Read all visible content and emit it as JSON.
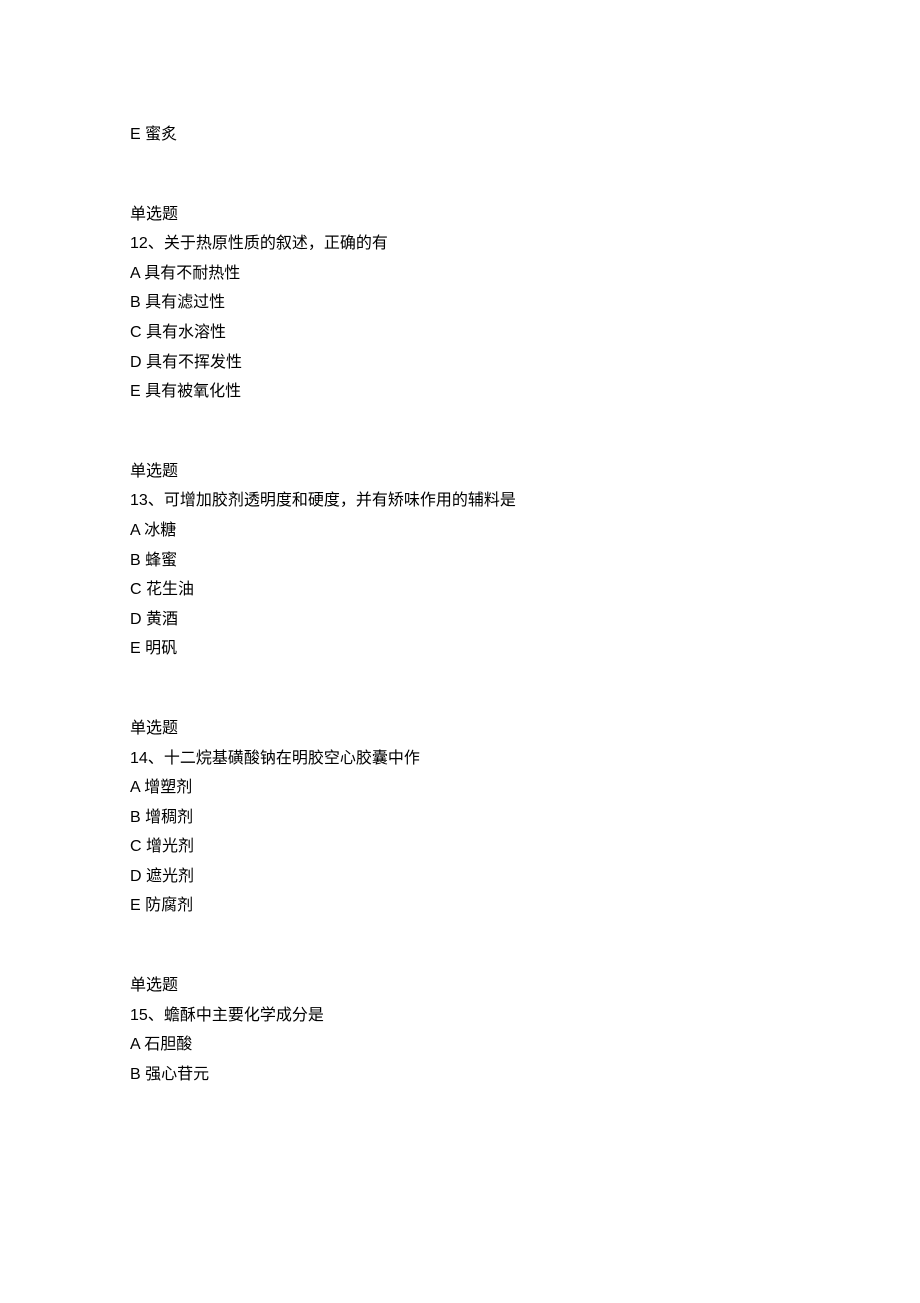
{
  "orphan_option": "E 蜜炙",
  "questions": [
    {
      "type": "单选题",
      "number": "12、",
      "text": "关于热原性质的叙述，正确的有",
      "options": [
        "A 具有不耐热性",
        "B 具有滤过性",
        "C 具有水溶性",
        "D 具有不挥发性",
        "E 具有被氧化性"
      ]
    },
    {
      "type": "单选题",
      "number": "13、",
      "text": "可增加胶剂透明度和硬度，并有矫味作用的辅料是",
      "options": [
        "A 冰糖",
        "B 蜂蜜",
        "C 花生油",
        "D 黄酒",
        "E 明矾"
      ]
    },
    {
      "type": "单选题",
      "number": "14、",
      "text": "十二烷基磺酸钠在明胶空心胶囊中作",
      "options": [
        "A 增塑剂",
        "B 增稠剂",
        "C 增光剂",
        "D 遮光剂",
        "E 防腐剂"
      ]
    },
    {
      "type": "单选题",
      "number": "15、",
      "text": "蟾酥中主要化学成分是",
      "options": [
        "A 石胆酸",
        "B 强心苷元"
      ]
    }
  ]
}
